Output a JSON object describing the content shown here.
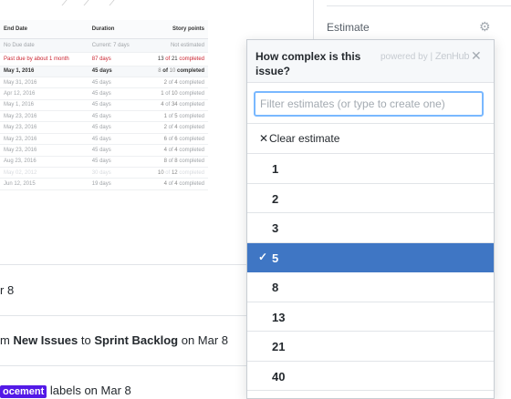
{
  "milestones_table": {
    "headers": [
      "End Date",
      "Duration",
      "Story points"
    ],
    "rows": [
      {
        "end": "No Due date",
        "duration": "Current: 7 days",
        "points": "Not estimated",
        "kind": "first"
      },
      {
        "end": "Past due by about 1 month",
        "duration": "87 days",
        "points_done": "13",
        "points_total": "21",
        "kind": "overdue"
      },
      {
        "end": "May 1, 2016",
        "duration": "45 days",
        "points_done": "8",
        "points_total": "10",
        "kind": "current"
      },
      {
        "end": "May 31, 2016",
        "duration": "45 days",
        "points_done": "2",
        "points_total": "4",
        "kind": "normal"
      },
      {
        "end": "Apr 12, 2016",
        "duration": "45 days",
        "points_done": "1",
        "points_total": "10",
        "kind": "normal"
      },
      {
        "end": "May 1, 2016",
        "duration": "45 days",
        "points_done": "4",
        "points_total": "34",
        "kind": "normal"
      },
      {
        "end": "May 23, 2016",
        "duration": "45 days",
        "points_done": "1",
        "points_total": "5",
        "kind": "normal"
      },
      {
        "end": "May 23, 2016",
        "duration": "45 days",
        "points_done": "2",
        "points_total": "4",
        "kind": "normal"
      },
      {
        "end": "May 23, 2016",
        "duration": "45 days",
        "points_done": "6",
        "points_total": "6",
        "kind": "normal"
      },
      {
        "end": "May 23, 2016",
        "duration": "45 days",
        "points_done": "4",
        "points_total": "4",
        "kind": "normal"
      },
      {
        "end": "Aug 23, 2016",
        "duration": "45 days",
        "points_done": "8",
        "points_total": "8",
        "kind": "normal"
      },
      {
        "end": "May 02, 2012",
        "duration": "30 days",
        "points_done": "10",
        "points_total": "12",
        "kind": "faded"
      },
      {
        "end": "Jun 12, 2015",
        "duration": "19 days",
        "points_done": "4",
        "points_total": "4",
        "kind": "normal"
      }
    ],
    "of_word": "of",
    "completed_word": "completed"
  },
  "activity": {
    "row1": {
      "text": "r 8"
    },
    "row2": {
      "prefix": "m ",
      "from": "New Issues",
      "mid": " to ",
      "to": "Sprint Backlog",
      "suffix": " on Mar 8"
    },
    "row3": {
      "label": "ocement",
      "suffix": " labels on Mar 8"
    }
  },
  "sidebar": {
    "estimate_heading": "Estimate"
  },
  "popover": {
    "title": "How complex is this issue?",
    "powered_by": "powered by |",
    "brand": "ZenHub",
    "filter_placeholder": "Filter estimates (or type to create one)",
    "filter_value": "",
    "clear_label": "Clear estimate",
    "options": [
      {
        "value": "1",
        "selected": false
      },
      {
        "value": "2",
        "selected": false
      },
      {
        "value": "3",
        "selected": false
      },
      {
        "value": "5",
        "selected": true
      },
      {
        "value": "8",
        "selected": false
      },
      {
        "value": "13",
        "selected": false
      },
      {
        "value": "21",
        "selected": false
      },
      {
        "value": "40",
        "selected": false
      }
    ]
  },
  "icons": {
    "gear": "gear-icon",
    "close": "close-icon",
    "clear": "x-icon",
    "check": "check-icon"
  },
  "colors": {
    "selected_bg": "#3f76c4",
    "label_bg": "#5319e7",
    "overdue": "#cb2431",
    "focus_border": "#79b8ff"
  }
}
